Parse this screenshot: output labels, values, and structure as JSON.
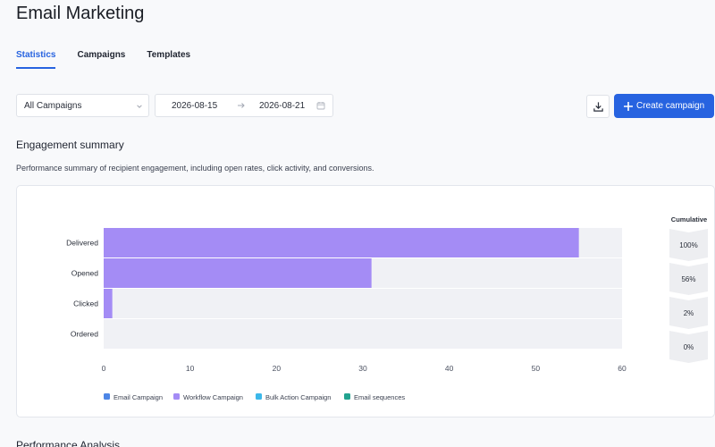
{
  "page": {
    "title": "Email Marketing"
  },
  "tabs": [
    {
      "label": "Statistics",
      "active": true
    },
    {
      "label": "Campaigns",
      "active": false
    },
    {
      "label": "Templates",
      "active": false
    }
  ],
  "toolbar": {
    "campaign_select": {
      "value": "All Campaigns"
    },
    "date_range": {
      "start": "2026-08-15",
      "end": "2026-08-21"
    },
    "download_icon": "download-icon",
    "create_label": "Create campaign"
  },
  "engagement": {
    "title": "Engagement summary",
    "description": "Performance summary of recipient engagement, including open rates, click activity, and conversions."
  },
  "next_section": {
    "title": "Performance Analysis"
  },
  "colors": {
    "accent": "#2763e0",
    "bar_workflow": "#a48cf5",
    "track": "#f0f1f5",
    "legend_email": "#4d86e6",
    "legend_workflow": "#a48cf5",
    "legend_bulk": "#3cb8ea",
    "legend_sequences": "#22a38f",
    "cumulative_bg": "#edeef1"
  },
  "chart_data": {
    "type": "bar",
    "orientation": "horizontal",
    "stacked": true,
    "categories": [
      "Delivered",
      "Opened",
      "Clicked",
      "Ordered"
    ],
    "series": [
      {
        "name": "Email Campaign",
        "values": [
          0,
          0,
          0,
          0
        ]
      },
      {
        "name": "Workflow Campaign",
        "values": [
          55,
          31,
          1,
          0
        ]
      },
      {
        "name": "Bulk Action Campaign",
        "values": [
          0,
          0,
          0,
          0
        ]
      },
      {
        "name": "Email sequences",
        "values": [
          0,
          0,
          0,
          0
        ]
      }
    ],
    "xlim": [
      0,
      60
    ],
    "xticks": [
      0,
      10,
      20,
      30,
      40,
      50,
      60
    ],
    "legend_position": "bottom",
    "cumulative": {
      "title": "Cumulative",
      "values": [
        "100%",
        "56%",
        "2%",
        "0%"
      ]
    }
  }
}
